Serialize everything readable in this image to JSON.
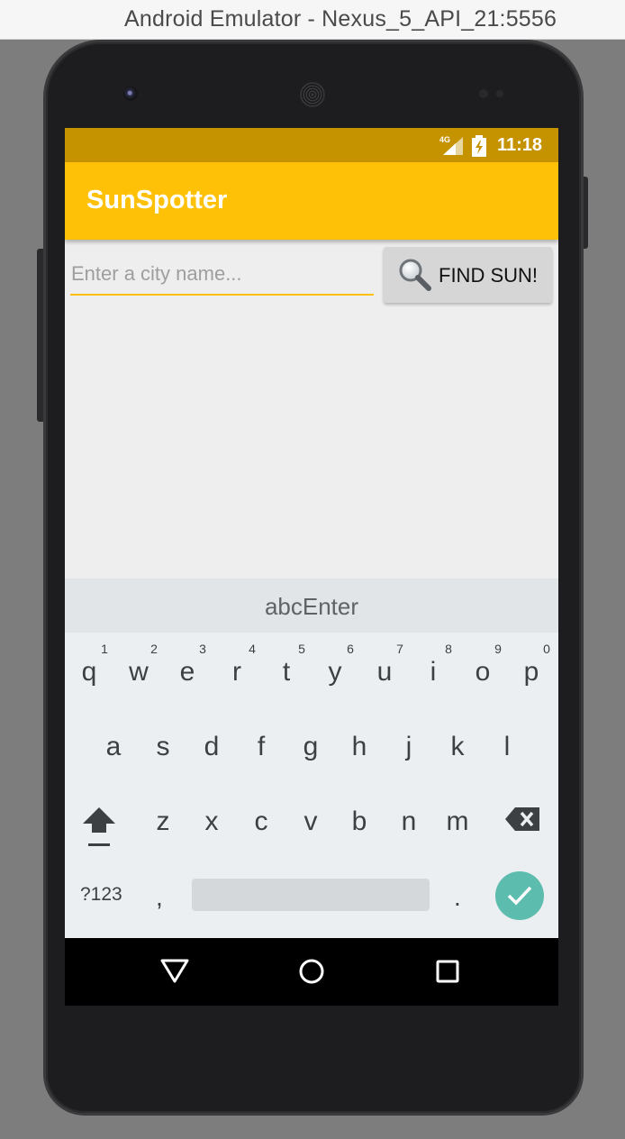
{
  "window": {
    "title": "Android Emulator - Nexus_5_API_21:5556"
  },
  "status_bar": {
    "time": "11:18",
    "network": "4G",
    "color": "#c59200"
  },
  "app_bar": {
    "title": "SunSpotter",
    "color": "#ffc107"
  },
  "search": {
    "placeholder": "Enter a city name...",
    "value": "",
    "button_label": "FIND SUN!",
    "button_icon": "search-icon"
  },
  "keyboard": {
    "suggestion": "abcEnter",
    "row1": [
      {
        "key": "q",
        "hint": "1"
      },
      {
        "key": "w",
        "hint": "2"
      },
      {
        "key": "e",
        "hint": "3"
      },
      {
        "key": "r",
        "hint": "4"
      },
      {
        "key": "t",
        "hint": "5"
      },
      {
        "key": "y",
        "hint": "6"
      },
      {
        "key": "u",
        "hint": "7"
      },
      {
        "key": "i",
        "hint": "8"
      },
      {
        "key": "o",
        "hint": "9"
      },
      {
        "key": "p",
        "hint": "0"
      }
    ],
    "row2": [
      "a",
      "s",
      "d",
      "f",
      "g",
      "h",
      "j",
      "k",
      "l"
    ],
    "row3": [
      "z",
      "x",
      "c",
      "v",
      "b",
      "n",
      "m"
    ],
    "symbols_label": "?123",
    "comma": ",",
    "period": ".",
    "shift_icon": "shift-icon",
    "backspace_icon": "backspace-icon",
    "enter_icon": "check-icon",
    "enter_color": "#5cbcae"
  },
  "nav_bar": {
    "back_icon": "back-triangle-icon",
    "home_icon": "home-circle-icon",
    "recent_icon": "recent-apps-square-icon"
  }
}
